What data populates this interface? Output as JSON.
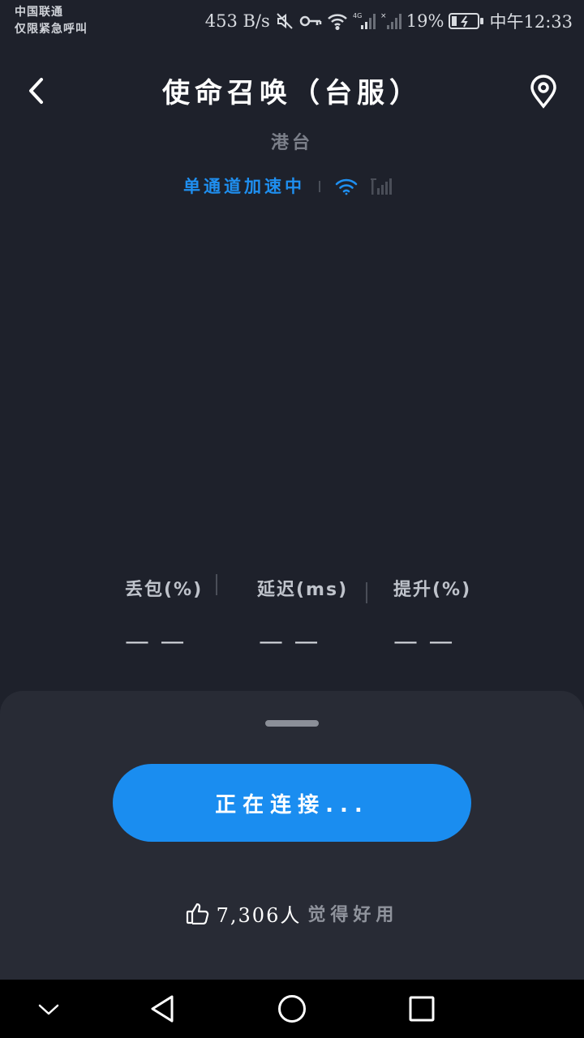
{
  "status_bar": {
    "carrier_line1": "中国联通",
    "carrier_line2": "仅限紧急呼叫",
    "net_speed": "453 B/s",
    "battery": "19%",
    "time": "中午12:33",
    "icons": [
      "mute-icon",
      "key-icon",
      "wifi-icon",
      "4g-signal-icon",
      "no-signal-icon",
      "battery-icon"
    ]
  },
  "header": {
    "title": "使命召唤（台服）",
    "region": "港台",
    "accel_status": "单通道加速中",
    "accent_color": "#1a8df0"
  },
  "stats": [
    {
      "label": "丢包(%)",
      "value": "— —"
    },
    {
      "label": "延迟(ms)",
      "value": "— —"
    },
    {
      "label": "提升(%)",
      "value": "— —"
    }
  ],
  "sheet": {
    "connect_label": "正在连接...",
    "likes_count": "7,306人",
    "likes_text": "觉得好用"
  },
  "nav": {
    "icons": [
      "chevron-down-icon",
      "back-triangle-icon",
      "home-circle-icon",
      "recents-square-icon"
    ]
  }
}
